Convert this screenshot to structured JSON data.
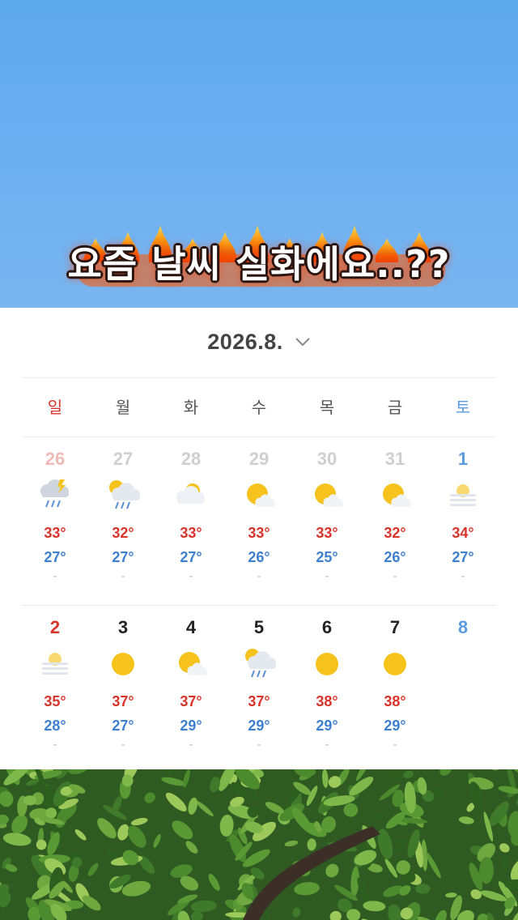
{
  "caption": "요즘 날씨 실화에요..??",
  "calendar": {
    "month_label": "2026.8.",
    "month_dropdown_icon": "chevron-down-icon",
    "weekdays": [
      "일",
      "월",
      "화",
      "수",
      "목",
      "금",
      "토"
    ],
    "weeks": [
      [
        {
          "day": "26",
          "icon": "thunderstorm-rain-icon",
          "high": "33°",
          "low": "27°",
          "extra": "-",
          "muted": true
        },
        {
          "day": "27",
          "icon": "sun-rain-icon",
          "high": "32°",
          "low": "27°",
          "extra": "-",
          "muted": true
        },
        {
          "day": "28",
          "icon": "partly-cloudy-icon",
          "high": "33°",
          "low": "27°",
          "extra": "-",
          "muted": true
        },
        {
          "day": "29",
          "icon": "mostly-sunny-icon",
          "high": "33°",
          "low": "26°",
          "extra": "-",
          "muted": true
        },
        {
          "day": "30",
          "icon": "mostly-sunny-icon",
          "high": "33°",
          "low": "25°",
          "extra": "-",
          "muted": true
        },
        {
          "day": "31",
          "icon": "mostly-sunny-icon",
          "high": "32°",
          "low": "26°",
          "extra": "-",
          "muted": true
        },
        {
          "day": "1",
          "icon": "haze-icon",
          "high": "34°",
          "low": "27°",
          "extra": "-",
          "muted": false
        }
      ],
      [
        {
          "day": "2",
          "icon": "haze-icon",
          "high": "35°",
          "low": "28°",
          "extra": "-",
          "muted": false
        },
        {
          "day": "3",
          "icon": "sunny-icon",
          "high": "37°",
          "low": "27°",
          "extra": "-",
          "muted": false
        },
        {
          "day": "4",
          "icon": "mostly-sunny-icon",
          "high": "37°",
          "low": "29°",
          "extra": "-",
          "muted": false
        },
        {
          "day": "5",
          "icon": "sun-rain-icon",
          "high": "37°",
          "low": "29°",
          "extra": "-",
          "muted": false
        },
        {
          "day": "6",
          "icon": "sunny-icon",
          "high": "38°",
          "low": "29°",
          "extra": "-",
          "muted": false
        },
        {
          "day": "7",
          "icon": "sunny-icon",
          "high": "38°",
          "low": "29°",
          "extra": "-",
          "muted": false
        },
        {
          "day": "8",
          "icon": "",
          "high": "",
          "low": "",
          "extra": "",
          "muted": false
        }
      ]
    ]
  },
  "colors": {
    "sunday": "#d9342b",
    "saturday": "#5b9be0",
    "weekday": "#222222",
    "muted_day": "#cfcfcf",
    "muted_sunday": "#f0b9b5",
    "high_temp": "#d9342b",
    "low_temp": "#3d7fd1",
    "sun": "#f6c31c",
    "sky": "#6aaef0"
  }
}
